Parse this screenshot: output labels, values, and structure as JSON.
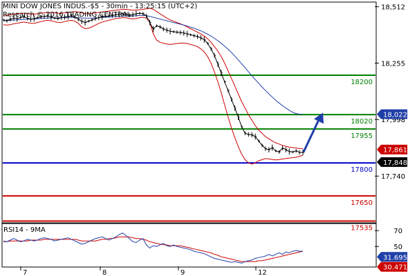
{
  "header": {
    "line1": "MINI DOW JONES INDUS.-$5 - 30min - 13:25:15 (UTC+2)",
    "line2": "Research © 2016 TRADING CENTRAL"
  },
  "chart_data": [
    {
      "type": "candlestick-line",
      "ylim": [
        17530,
        18530
      ],
      "y_ticks": [
        "18,512",
        "18,255",
        "17,998",
        "17,740"
      ],
      "y_tick_values": [
        18512,
        18255,
        17998,
        17740
      ],
      "x_tick_labels": [
        "7",
        "8",
        "9",
        "12"
      ],
      "price_series": [
        18452,
        18448,
        18455,
        18460,
        18458,
        18462,
        18466,
        18460,
        18455,
        18458,
        18462,
        18465,
        18468,
        18470,
        18466,
        18460,
        18458,
        18462,
        18465,
        18468,
        18470,
        18464,
        18455,
        18445,
        18440,
        18446,
        18452,
        18458,
        18462,
        18466,
        18468,
        18470,
        18472,
        18476,
        18478,
        18480,
        18478,
        18474,
        18476,
        18480,
        18482,
        18480,
        18470,
        18440,
        18410,
        18425,
        18420,
        18410,
        18405,
        18400,
        18398,
        18396,
        18394,
        18392,
        18388,
        18384,
        18380,
        18376,
        18370,
        18362,
        18345,
        18320,
        18290,
        18250,
        18210,
        18170,
        18130,
        18090,
        18050,
        18010,
        17965,
        17935,
        17930,
        17928,
        17920,
        17900,
        17880,
        17865,
        17860,
        17870,
        17855,
        17850,
        17868,
        17860,
        17852,
        17850,
        17855,
        17848,
        17848
      ],
      "bollinger_upper": [
        18470,
        18472,
        18475,
        18478,
        18480,
        18482,
        18482,
        18480,
        18478,
        18478,
        18480,
        18482,
        18484,
        18486,
        18486,
        18484,
        18482,
        18482,
        18484,
        18486,
        18488,
        18490,
        18488,
        18484,
        18480,
        18480,
        18482,
        18484,
        18486,
        18488,
        18490,
        18492,
        18494,
        18496,
        18498,
        18500,
        18500,
        18498,
        18496,
        18496,
        18498,
        18500,
        18502,
        18505,
        18500,
        18490,
        18480,
        18470,
        18460,
        18452,
        18446,
        18440,
        18434,
        18428,
        18420,
        18412,
        18404,
        18396,
        18388,
        18378,
        18366,
        18350,
        18330,
        18310,
        18285,
        18255,
        18220,
        18185,
        18150,
        18115,
        18080,
        18050,
        18020,
        17995,
        17970,
        17950,
        17935,
        17920,
        17910,
        17900,
        17892,
        17886,
        17880,
        17876,
        17872,
        17870,
        17868,
        17866,
        17865
      ],
      "bollinger_lower": [
        18430,
        18428,
        18430,
        18434,
        18436,
        18440,
        18442,
        18440,
        18436,
        18436,
        18440,
        18444,
        18448,
        18450,
        18448,
        18444,
        18440,
        18440,
        18444,
        18448,
        18450,
        18446,
        18436,
        18420,
        18412,
        18414,
        18420,
        18428,
        18436,
        18442,
        18446,
        18450,
        18454,
        18458,
        18460,
        18462,
        18462,
        18458,
        18456,
        18458,
        18462,
        18464,
        18460,
        18440,
        18390,
        18360,
        18350,
        18345,
        18342,
        18340,
        18342,
        18344,
        18346,
        18346,
        18344,
        18340,
        18336,
        18330,
        18320,
        18306,
        18285,
        18255,
        18215,
        18170,
        18120,
        18065,
        18010,
        17960,
        17915,
        17875,
        17840,
        17815,
        17800,
        17795,
        17800,
        17810,
        17815,
        17820,
        17818,
        17816,
        17814,
        17815,
        17818,
        17820,
        17822,
        17824,
        17826,
        17830,
        17835
      ],
      "moving_average": [
        18448,
        18449,
        18450,
        18451,
        18452,
        18453,
        18454,
        18455,
        18455,
        18456,
        18457,
        18458,
        18459,
        18460,
        18461,
        18461,
        18461,
        18462,
        18462,
        18463,
        18463,
        18463,
        18462,
        18461,
        18460,
        18460,
        18460,
        18461,
        18462,
        18463,
        18464,
        18465,
        18466,
        18467,
        18468,
        18469,
        18470,
        18470,
        18470,
        18471,
        18472,
        18472,
        18471,
        18468,
        18464,
        18460,
        18456,
        18452,
        18448,
        18444,
        18440,
        18436,
        18432,
        18428,
        18424,
        18419,
        18414,
        18408,
        18402,
        18395,
        18387,
        18378,
        18368,
        18357,
        18345,
        18332,
        18318,
        18303,
        18287,
        18270,
        18252,
        18234,
        18216,
        18198,
        18180,
        18163,
        18146,
        18130,
        18115,
        18100,
        18086,
        18073,
        18061,
        18050,
        18040,
        18031,
        18025,
        18022,
        18022
      ],
      "horizontal_levels": [
        {
          "value": 18200,
          "label": "18200",
          "color": "#008000"
        },
        {
          "value": 18020,
          "label": "18020",
          "color": "#008000"
        },
        {
          "value": 17955,
          "label": "17955",
          "color": "#008000"
        },
        {
          "value": 17800,
          "label": "17800",
          "color": "#0000cc"
        },
        {
          "value": 17650,
          "label": "17650",
          "color": "#cc0000"
        },
        {
          "value": 17535,
          "label": "17535",
          "color": "#cc0000"
        }
      ],
      "price_tags": [
        {
          "value": 18022,
          "text": "18,022.2",
          "bg": "#1f3fa8",
          "fg": "#ffffff"
        },
        {
          "value": 17861,
          "text": "17,861",
          "bg": "#cc0000",
          "fg": "#ffffff"
        },
        {
          "value": 17848,
          "text": "17,848",
          "bg": "#000000",
          "fg": "#ffffff"
        }
      ],
      "forecast_arrow": {
        "from_value": 17850,
        "to_value": 18010,
        "color": "#1f3fa8"
      },
      "colors": {
        "price": "#000000",
        "bollinger": "#cc0000",
        "moving_average": "#1f3fa8"
      }
    },
    {
      "type": "line",
      "title": "RSI14 - 9MA",
      "ylim": [
        25,
        78
      ],
      "y_ticks": [
        "70",
        "50"
      ],
      "y_tick_values": [
        70,
        50
      ],
      "series": [
        {
          "name": "RSI14",
          "values": [
            57,
            56,
            58,
            60,
            58,
            56,
            57,
            59,
            58,
            57,
            58,
            60,
            61,
            60,
            59,
            57,
            58,
            59,
            60,
            61,
            59,
            57,
            55,
            53,
            54,
            56,
            58,
            60,
            61,
            62,
            60,
            58,
            60,
            62,
            65,
            67,
            64,
            60,
            56,
            55,
            58,
            60,
            52,
            48,
            51,
            50,
            52,
            54,
            51,
            50,
            52,
            50,
            49,
            48,
            47,
            46,
            44,
            43,
            42,
            41,
            39,
            37,
            35,
            34,
            33,
            32,
            31,
            30,
            31,
            30,
            29,
            31,
            32,
            33,
            35,
            36,
            37,
            38,
            40,
            38,
            40,
            42,
            40,
            43,
            42,
            44,
            45,
            44,
            44
          ]
        },
        {
          "name": "9MA",
          "values": [
            56,
            56,
            57,
            57,
            57,
            57,
            57,
            57,
            58,
            58,
            58,
            58,
            59,
            59,
            59,
            59,
            59,
            59,
            59,
            59,
            59,
            59,
            58,
            57,
            57,
            57,
            57,
            57,
            58,
            59,
            59,
            60,
            60,
            61,
            62,
            62,
            62,
            62,
            61,
            60,
            60,
            59,
            58,
            56,
            55,
            54,
            53,
            52,
            52,
            51,
            51,
            51,
            51,
            50,
            49,
            48,
            47,
            46,
            45,
            44,
            43,
            42,
            40,
            39,
            37,
            36,
            35,
            34,
            33,
            32,
            31,
            31,
            31,
            31,
            31,
            32,
            32,
            33,
            34,
            35,
            36,
            37,
            38,
            39,
            40,
            41,
            42,
            43,
            44
          ]
        }
      ],
      "value_tags": [
        {
          "value": 31.6955,
          "text": "31.6955",
          "bg": "#1f3fa8",
          "fg": "#ffffff"
        },
        {
          "value": 30.4716,
          "text": "30.4716",
          "bg": "#cc0000",
          "fg": "#ffffff"
        }
      ],
      "colors": {
        "rsi": "#1f3fa8",
        "ma": "#cc0000"
      }
    }
  ]
}
